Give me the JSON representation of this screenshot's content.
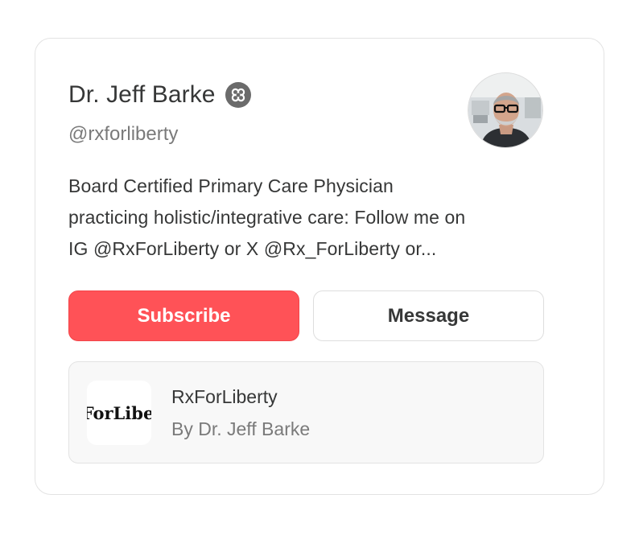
{
  "profile": {
    "name": "Dr. Jeff Barke",
    "handle": "@rxforliberty",
    "verified_icon": "badge-icon",
    "avatar_alt": "Dr. Jeff Barke profile photo",
    "bio_lines": [
      "Board Certified Primary Care Physician",
      "practicing holistic/integrative care: Follow me on",
      "IG @RxForLiberty or X @Rx_ForLiberty or..."
    ]
  },
  "actions": {
    "subscribe_label": "Subscribe",
    "message_label": "Message"
  },
  "publication": {
    "title": "RxForLiberty",
    "byline": "By Dr. Jeff Barke",
    "logo_text": "RxForLiberty"
  },
  "colors": {
    "accent": "#ff5257",
    "text": "#363737",
    "muted": "#7a7a7a",
    "border": "#e3e3e3"
  }
}
